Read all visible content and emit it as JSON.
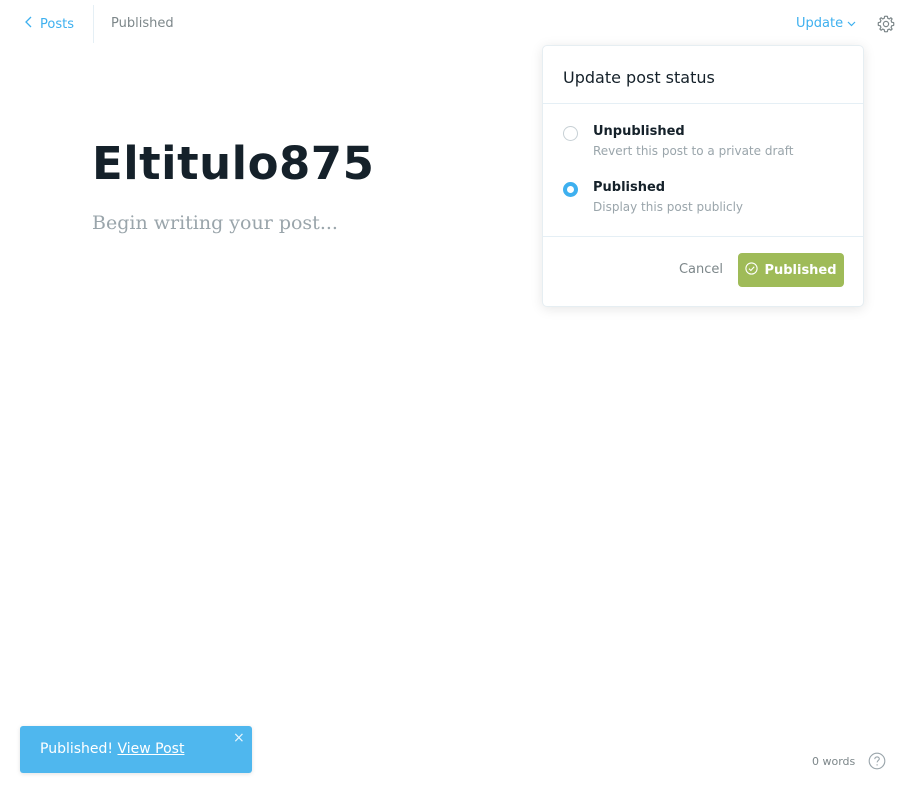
{
  "topbar": {
    "back_label": "Posts",
    "status": "Published",
    "update_label": "Update"
  },
  "editor": {
    "title": "Eltitulo875",
    "body_placeholder": "Begin writing your post..."
  },
  "popover": {
    "title": "Update post status",
    "options": [
      {
        "label": "Unpublished",
        "description": "Revert this post to a private draft",
        "selected": false
      },
      {
        "label": "Published",
        "description": "Display this post publicly",
        "selected": true
      }
    ],
    "cancel_label": "Cancel",
    "confirm_label": "Published"
  },
  "toast": {
    "message": "Published!",
    "link_label": "View Post",
    "close_symbol": "×"
  },
  "footer": {
    "word_count": "0 words"
  },
  "colors": {
    "accent_blue": "#3eb0ef",
    "publish_green": "#9fbb58",
    "toast_blue": "#4fb7ee",
    "text_dark": "#15212a",
    "text_muted": "#9aa5ab"
  },
  "icons": {
    "back": "chevron-left-icon",
    "update_caret": "chevron-down-icon",
    "settings": "gear-icon",
    "confirm": "check-circle-icon",
    "close": "close-icon",
    "help": "question-circle-icon"
  }
}
